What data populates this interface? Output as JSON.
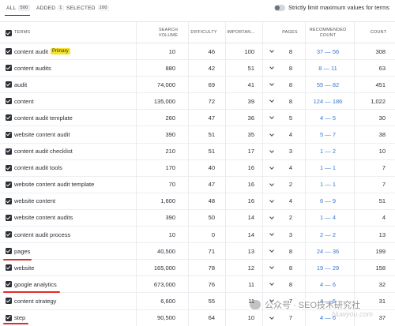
{
  "tabs": {
    "all": {
      "label": "ALL",
      "count": "500"
    },
    "added": {
      "label": "ADDED",
      "count": "1"
    },
    "selected": {
      "label": "SELECTED",
      "count": "100"
    }
  },
  "toggle": {
    "label": "Strictly limit maximum values for terms",
    "info": "?"
  },
  "headers": {
    "terms": "TERMS",
    "search_volume": "SEARCH VOLUME",
    "difficulty": "DIFFICULTY",
    "importance": "IMPORTAN...",
    "pages": "PAGES",
    "recommended_count": "RECOMMENDED COUNT",
    "count": "COUNT"
  },
  "rows": [
    {
      "term": "content audit",
      "badge": "Primary",
      "sv": "10",
      "diff": "46",
      "imp": "100",
      "pages": "8",
      "rc": "37 — 56",
      "count": "308"
    },
    {
      "term": "content audits",
      "sv": "880",
      "diff": "42",
      "imp": "51",
      "pages": "8",
      "rc": "8 — 11",
      "count": "63"
    },
    {
      "term": "audit",
      "sv": "74,000",
      "diff": "69",
      "imp": "41",
      "pages": "8",
      "rc": "55 — 82",
      "count": "451"
    },
    {
      "term": "content",
      "sv": "135,000",
      "diff": "72",
      "imp": "39",
      "pages": "8",
      "rc": "124 — 186",
      "count": "1,022"
    },
    {
      "term": "content audit template",
      "sv": "260",
      "diff": "47",
      "imp": "36",
      "pages": "5",
      "rc": "4 — 5",
      "count": "30"
    },
    {
      "term": "website content audit",
      "sv": "390",
      "diff": "51",
      "imp": "35",
      "pages": "4",
      "rc": "5 — 7",
      "count": "38"
    },
    {
      "term": "content audit checklist",
      "sv": "210",
      "diff": "51",
      "imp": "17",
      "pages": "3",
      "rc": "1 — 2",
      "count": "10"
    },
    {
      "term": "content audit tools",
      "sv": "170",
      "diff": "40",
      "imp": "16",
      "pages": "4",
      "rc": "1 — 1",
      "count": "7"
    },
    {
      "term": "website content audit template",
      "sv": "70",
      "diff": "47",
      "imp": "16",
      "pages": "2",
      "rc": "1 — 1",
      "count": "7"
    },
    {
      "term": "website content",
      "sv": "1,600",
      "diff": "48",
      "imp": "16",
      "pages": "4",
      "rc": "6 — 9",
      "count": "51"
    },
    {
      "term": "website content audits",
      "sv": "390",
      "diff": "50",
      "imp": "14",
      "pages": "2",
      "rc": "1 — 4",
      "count": "4"
    },
    {
      "term": "content audit process",
      "sv": "10",
      "diff": "0",
      "imp": "14",
      "pages": "3",
      "rc": "2 — 2",
      "count": "13"
    },
    {
      "term": "pages",
      "sv": "40,500",
      "diff": "71",
      "imp": "13",
      "pages": "8",
      "rc": "24 — 36",
      "count": "199"
    },
    {
      "term": "website",
      "sv": "165,000",
      "diff": "78",
      "imp": "12",
      "pages": "8",
      "rc": "19 — 29",
      "count": "158"
    },
    {
      "term": "google analytics",
      "sv": "673,000",
      "diff": "76",
      "imp": "11",
      "pages": "8",
      "rc": "4 — 6",
      "count": "32"
    },
    {
      "term": "content strategy",
      "sv": "6,600",
      "diff": "55",
      "imp": "11",
      "pages": "7",
      "rc": "4 — 6",
      "count": "31"
    },
    {
      "term": "step",
      "sv": "90,500",
      "diff": "64",
      "imp": "10",
      "pages": "7",
      "rc": "4 — 6",
      "count": "37"
    }
  ],
  "watermark": {
    "text": "公众号 · SEO技术研究社",
    "url": "Nuwyou.com"
  }
}
